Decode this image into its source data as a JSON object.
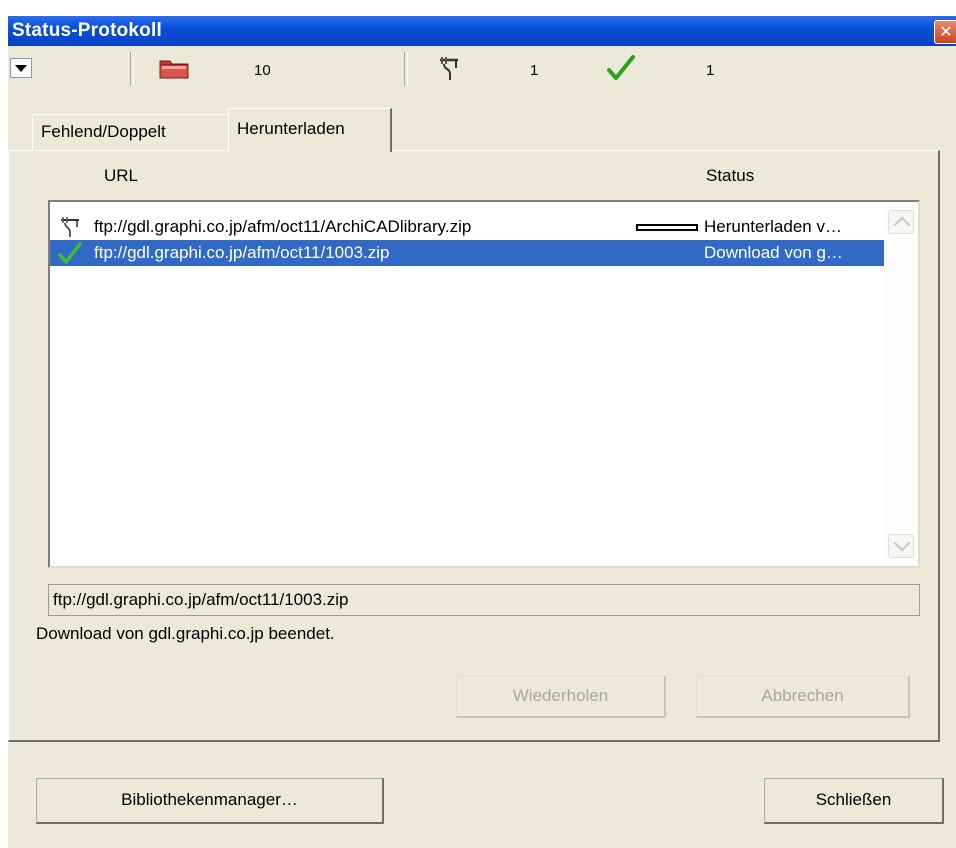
{
  "window": {
    "title": "Status-Protokoll"
  },
  "toolbar": {
    "missing_count": "10",
    "downloading_count": "1",
    "completed_count": "1"
  },
  "tabs": [
    {
      "label": "Fehlend/Doppelt",
      "active": false
    },
    {
      "label": "Herunterladen",
      "active": true
    }
  ],
  "table": {
    "columns": {
      "url": "URL",
      "status": "Status"
    },
    "rows": [
      {
        "icon": "plug-icon",
        "url": "ftp://gdl.graphi.co.jp/afm/oct11/ArchiCADlibrary.zip",
        "status": "Herunterladen v…",
        "progress": 0.0,
        "selected": false
      },
      {
        "icon": "checkmark-icon",
        "url": "ftp://gdl.graphi.co.jp/afm/oct11/1003.zip",
        "status": "Download von g…",
        "selected": true
      }
    ]
  },
  "details": {
    "selected_url": "ftp://gdl.graphi.co.jp/afm/oct11/1003.zip",
    "message": "Download von gdl.graphi.co.jp beendet."
  },
  "buttons": {
    "retry": "Wiederholen",
    "cancel": "Abbrechen",
    "library_manager": "Bibliothekenmanager…",
    "close": "Schließen"
  },
  "colors": {
    "titlebar": "#0A4FD8",
    "selection": "#316AC5",
    "dialog_bg": "#ECE9D8",
    "check_green": "#2E9E1F",
    "folder_red": "#C0392B"
  }
}
